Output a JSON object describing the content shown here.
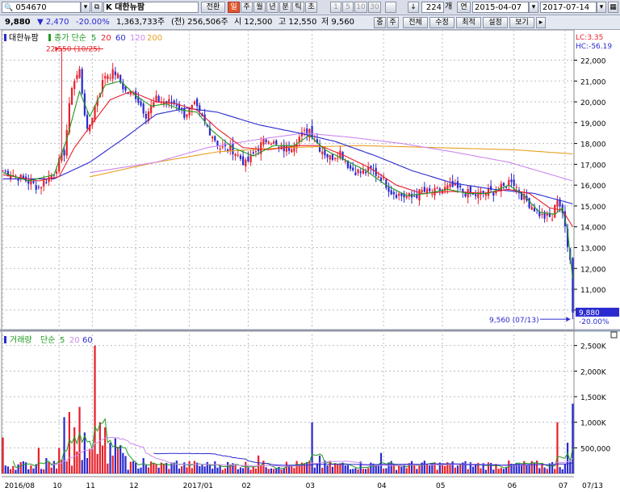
{
  "toolbar": {
    "code": "054670",
    "name": "K 대한뉴팜",
    "btn_realtime": "전환",
    "period_tabs": [
      "일",
      "주",
      "월",
      "년",
      "분",
      "틱",
      "초"
    ],
    "active_tab": "일",
    "interval_tabs": [
      "1",
      "5",
      "10",
      "30"
    ],
    "bar_count": "224",
    "bar_count_unit": "개",
    "btn_consecutive": "연",
    "date_start": "2015-04-07",
    "date_end": "2017-07-14"
  },
  "quote": {
    "price": "9,880",
    "change": "▼ 2,470",
    "change_pct": "-20.00%",
    "volume": "1,363,733주",
    "prev_volume": "(전) 256,506주",
    "open": "시 12,500",
    "high": "고 12,550",
    "low": "저 9,560"
  },
  "toolbar2_buttons": {
    "left1": "중",
    "left2": "주",
    "all": "전체",
    "adjust": "수정",
    "optimize": "최적",
    "settings": "설정",
    "view": "보기"
  },
  "colors": {
    "up": "#e8202a",
    "down": "#2a2ad0",
    "ma5": "#1f9a1f",
    "ma20": "#e8202a",
    "ma60": "#2a2ad0",
    "ma120": "#cc88ee",
    "ma200": "#e8a020",
    "grid": "#b8bcc8"
  },
  "chart_data": [
    {
      "type": "candlestick",
      "legend": [
        "대한뉴팜",
        "종가 단순",
        "5",
        "20",
        "60",
        "120",
        "200"
      ],
      "y_ticks": [
        22000,
        21000,
        20000,
        19000,
        18000,
        17000,
        16000,
        15000,
        14000,
        13000,
        12000,
        11000,
        10000
      ],
      "y_tick_labels": [
        "22,000",
        "21,000",
        "20,000",
        "19,000",
        "18,000",
        "17,000",
        "16,000",
        "15,000",
        "14,000",
        "13,000",
        "12,000",
        "11,000",
        "10,000"
      ],
      "ylim": [
        9100,
        23300
      ],
      "x_labels": [
        "2016/08",
        "10",
        "11",
        "12",
        "2017/01",
        "02",
        "03",
        "04",
        "05",
        "06",
        "07"
      ],
      "x_label_bar_index": [
        0,
        22,
        35,
        52,
        73,
        96,
        121,
        149,
        172,
        200,
        220
      ],
      "last_label": "07/13",
      "lc_label": "LC:3.35",
      "hc_label": "HC:-56.19",
      "max_annotation": "22,550 (10/25)",
      "max_bar_index": 23,
      "max_value": 22550,
      "min_annotation": "9,560 (07/13)",
      "min_bar_index": 223,
      "min_value": 9560,
      "last_price_label": "9,880",
      "last_pct_label": "-20.00%",
      "last_close": 9880,
      "series_close_keypoints": [
        [
          0,
          16700
        ],
        [
          8,
          16300
        ],
        [
          14,
          15900
        ],
        [
          20,
          16600
        ],
        [
          24,
          17600
        ],
        [
          27,
          20800
        ],
        [
          30,
          21500
        ],
        [
          33,
          18500
        ],
        [
          36,
          19800
        ],
        [
          40,
          21300
        ],
        [
          44,
          21400
        ],
        [
          48,
          20500
        ],
        [
          52,
          20300
        ],
        [
          56,
          19400
        ],
        [
          60,
          20100
        ],
        [
          64,
          20000
        ],
        [
          68,
          19900
        ],
        [
          71,
          19400
        ],
        [
          75,
          19800
        ],
        [
          80,
          18800
        ],
        [
          85,
          17800
        ],
        [
          90,
          17700
        ],
        [
          95,
          17000
        ],
        [
          100,
          17800
        ],
        [
          104,
          18300
        ],
        [
          108,
          17700
        ],
        [
          112,
          17800
        ],
        [
          116,
          18300
        ],
        [
          120,
          18700
        ],
        [
          124,
          17800
        ],
        [
          128,
          17300
        ],
        [
          132,
          17600
        ],
        [
          136,
          16800
        ],
        [
          140,
          16600
        ],
        [
          144,
          16700
        ],
        [
          148,
          16400
        ],
        [
          152,
          15700
        ],
        [
          156,
          15500
        ],
        [
          160,
          15400
        ],
        [
          164,
          15700
        ],
        [
          168,
          15600
        ],
        [
          172,
          15800
        ],
        [
          176,
          15900
        ],
        [
          180,
          15700
        ],
        [
          184,
          15500
        ],
        [
          188,
          15600
        ],
        [
          192,
          15700
        ],
        [
          196,
          15900
        ],
        [
          199,
          16300
        ],
        [
          203,
          15500
        ],
        [
          207,
          15000
        ],
        [
          211,
          14500
        ],
        [
          215,
          14400
        ],
        [
          217,
          15400
        ],
        [
          219,
          14700
        ],
        [
          221,
          13000
        ],
        [
          222,
          12400
        ],
        [
          223,
          9880
        ]
      ],
      "ma_keypoints": {
        "ma5": [
          [
            0,
            16600
          ],
          [
            10,
            16200
          ],
          [
            20,
            16500
          ],
          [
            25,
            18200
          ],
          [
            30,
            20500
          ],
          [
            34,
            19300
          ],
          [
            40,
            20800
          ],
          [
            46,
            21000
          ],
          [
            52,
            20300
          ],
          [
            58,
            19800
          ],
          [
            64,
            19900
          ],
          [
            70,
            19600
          ],
          [
            76,
            19500
          ],
          [
            82,
            18600
          ],
          [
            90,
            17800
          ],
          [
            98,
            17400
          ],
          [
            106,
            17900
          ],
          [
            114,
            17900
          ],
          [
            120,
            18400
          ],
          [
            126,
            17700
          ],
          [
            134,
            17200
          ],
          [
            142,
            16700
          ],
          [
            150,
            16000
          ],
          [
            158,
            15500
          ],
          [
            166,
            15600
          ],
          [
            174,
            15800
          ],
          [
            182,
            15600
          ],
          [
            190,
            15600
          ],
          [
            198,
            16000
          ],
          [
            204,
            15500
          ],
          [
            210,
            14700
          ],
          [
            216,
            14600
          ],
          [
            219,
            14900
          ],
          [
            221,
            13800
          ],
          [
            223,
            11500
          ]
        ],
        "ma20": [
          [
            0,
            16500
          ],
          [
            14,
            16200
          ],
          [
            22,
            16400
          ],
          [
            28,
            17800
          ],
          [
            34,
            18800
          ],
          [
            42,
            20100
          ],
          [
            50,
            20500
          ],
          [
            60,
            20000
          ],
          [
            68,
            19900
          ],
          [
            76,
            19600
          ],
          [
            84,
            18700
          ],
          [
            94,
            17800
          ],
          [
            104,
            17700
          ],
          [
            116,
            17900
          ],
          [
            124,
            17900
          ],
          [
            134,
            17400
          ],
          [
            144,
            16800
          ],
          [
            154,
            16000
          ],
          [
            164,
            15600
          ],
          [
            176,
            15700
          ],
          [
            188,
            15600
          ],
          [
            198,
            15800
          ],
          [
            206,
            15600
          ],
          [
            214,
            14900
          ],
          [
            219,
            14800
          ],
          [
            223,
            14000
          ]
        ],
        "ma60": [
          [
            0,
            16300
          ],
          [
            20,
            16300
          ],
          [
            34,
            17100
          ],
          [
            48,
            18300
          ],
          [
            60,
            19400
          ],
          [
            72,
            19700
          ],
          [
            84,
            19500
          ],
          [
            100,
            18900
          ],
          [
            116,
            18500
          ],
          [
            130,
            18100
          ],
          [
            146,
            17400
          ],
          [
            160,
            16700
          ],
          [
            176,
            16100
          ],
          [
            192,
            15800
          ],
          [
            208,
            15600
          ],
          [
            223,
            15100
          ]
        ],
        "ma120": [
          [
            34,
            16600
          ],
          [
            60,
            17100
          ],
          [
            80,
            17800
          ],
          [
            100,
            18200
          ],
          [
            118,
            18500
          ],
          [
            136,
            18300
          ],
          [
            156,
            18000
          ],
          [
            176,
            17600
          ],
          [
            198,
            17100
          ],
          [
            223,
            16200
          ]
        ],
        "ma200": [
          [
            34,
            16400
          ],
          [
            60,
            17100
          ],
          [
            84,
            17600
          ],
          [
            110,
            17800
          ],
          [
            140,
            17900
          ],
          [
            170,
            17800
          ],
          [
            200,
            17700
          ],
          [
            223,
            17500
          ]
        ]
      }
    },
    {
      "type": "bar",
      "name": "거래량",
      "legend": [
        "거래량",
        "단순",
        "5",
        "20",
        "60"
      ],
      "y_ticks": [
        500000,
        1000000,
        1500000,
        2000000,
        2500000
      ],
      "y_tick_labels": [
        "500,000",
        "1,000K",
        "1,500K",
        "2,000K",
        "2,500K"
      ],
      "ylim": [
        0,
        2700000
      ],
      "volume_spikes": [
        [
          0,
          700000
        ],
        [
          14,
          500000
        ],
        [
          17,
          300000
        ],
        [
          22,
          500000
        ],
        [
          24,
          1100000
        ],
        [
          26,
          1200000
        ],
        [
          28,
          900000
        ],
        [
          30,
          1300000
        ],
        [
          32,
          800000
        ],
        [
          33,
          300000
        ],
        [
          36,
          2500000
        ],
        [
          38,
          1000000
        ],
        [
          40,
          900000
        ],
        [
          42,
          600000
        ],
        [
          44,
          700000
        ],
        [
          47,
          400000
        ],
        [
          55,
          300000
        ],
        [
          68,
          250000
        ],
        [
          100,
          350000
        ],
        [
          121,
          1000000
        ],
        [
          124,
          350000
        ],
        [
          148,
          400000
        ],
        [
          172,
          200000
        ],
        [
          217,
          1000000
        ],
        [
          221,
          600000
        ],
        [
          223,
          1363733
        ]
      ],
      "volume_base": 170000
    }
  ]
}
